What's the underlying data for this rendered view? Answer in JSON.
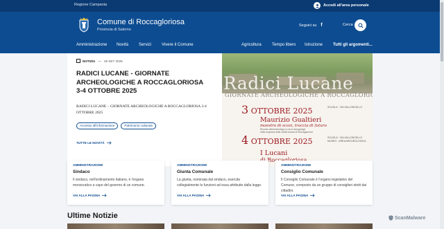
{
  "slim_header": {
    "region": "Regione Campania",
    "login_label": "Accedi all'area personale"
  },
  "center_header": {
    "site_name": "Comune di Roccagloriosa",
    "province": "Provincia di Salerno",
    "follow_label": "Seguici su",
    "social_icon": "facebook-icon",
    "search_label": "Cerca"
  },
  "nav": {
    "left": [
      "Amministrazione",
      "Novità",
      "Servizi",
      "Vivere il Comune"
    ],
    "right": [
      "Agricoltura",
      "Tempo libero",
      "Istruzione",
      "Tutti gli argomenti..."
    ]
  },
  "hero": {
    "category": "NOTIZIA",
    "date": "29 SET 2025",
    "title": "RADICI LUCANE - GIORNATE ARCHEOLOGICHE A ROCCAGLORIOSA 3-4 OTTOBRE 2025",
    "description": "RADICI LUCANE – GIORNATE ARCHEOLOGICHE A ROCCAGLORIOSA 3-4 OTTOBRE 2025",
    "tags": [
      "Accesso all'informazione",
      "Patrimonio culturale"
    ],
    "all_news": "TUTTE LE NOVITÀ",
    "poster": {
      "title": "Radici Lucane",
      "subtitle": "GIORNATE ARCHEOLOGICHE A ROCCAGLORIOSA",
      "events": [
        {
          "day": "3",
          "month": "OTTOBRE 2025",
          "location_1": "SCUOLA · VIA VALLONCELLO",
          "location_2": "",
          "speaker": "Maurizio Gualtieri",
          "topic": "maestro di scavi, traccia di futuro",
          "note_1": "Ricordo dell'archeologo a cui si ricongiunge",
          "note_2": "nella scoperta della civiltà lucana di Roccagloriosa"
        },
        {
          "day": "4",
          "month": "OTTOBRE 2025",
          "location_1": "SCUOLA · VIA VALLONCELLO",
          "location_2": "MUSEO · AREA ARCHEOLOGICA",
          "speaker": "I Lucani",
          "topic": "di Roccagloriosa",
          "note_1": "",
          "note_2": ""
        }
      ]
    }
  },
  "cards": [
    {
      "label": "AMMINISTRAZIONE",
      "title": "Sindaco",
      "text": "Il sindaco, nell'ordinamento italiano, è l'organo monocratico a capo del governo di un comune.",
      "link": "VAI ALLA PAGINA"
    },
    {
      "label": "AMMINISTRAZIONE",
      "title": "Giunta Comunale",
      "text": "La giunta, nominata dal sindaco, esercita collegialmente le funzioni ad essa attribuite dalla legge.",
      "link": "VAI ALLA PAGINA"
    },
    {
      "label": "AMMINISTRAZIONE",
      "title": "Consiglio Comunale",
      "text": "Il Consiglio Comunale è l'organo legislativo del Comune, composto da un gruppo di consiglieri eletti dai cittadini.",
      "link": "VAI ALLA PAGINA"
    }
  ],
  "section_title": "Ultime Notizie",
  "watermark": "ScanMalware",
  "colors": {
    "primary": "#0d4c91",
    "slim": "#0b3a72",
    "poster_accent": "#9b1b22"
  }
}
